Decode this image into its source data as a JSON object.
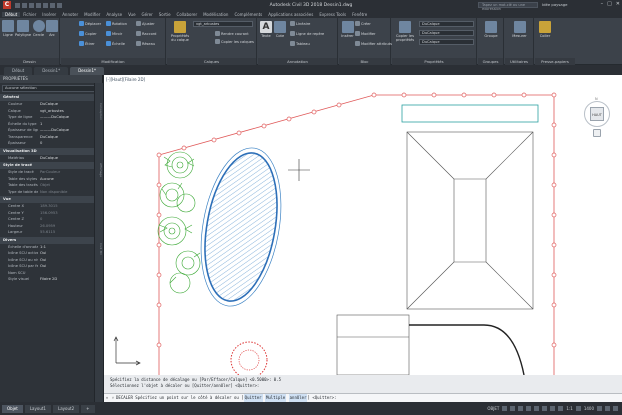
{
  "app": {
    "title": "Autodesk Civil 3D 2018   Dessin1.dwg",
    "search_placeholder": "Tapez un mot-clé ou une expression",
    "user_label": "Idée paysage"
  },
  "ribbon_tabs": [
    "Début",
    "Fichier",
    "Insérer",
    "Annoter",
    "Modifier",
    "Analyse",
    "Vue",
    "Gérer",
    "Sortie",
    "Collaborer",
    "Modélisation",
    "Compléments",
    "Applications associées",
    "Express Tools",
    "Fenêtre"
  ],
  "ribbon": {
    "draw": {
      "title": "Dessin",
      "buttons": [
        "Ligne",
        "Polyligne",
        "Cercle",
        "Arc"
      ]
    },
    "modify": {
      "title": "Modification",
      "buttons": [
        "Déplacer",
        "Rotation",
        "Ajuster",
        "Copier",
        "Miroir",
        "Raccord",
        "Étirer",
        "Échelle",
        "Réseau"
      ]
    },
    "layers": {
      "title": "Calques",
      "big": "Propriétés du calque",
      "combo": "vgt_arbustes",
      "buttons": [
        "Rendre courant",
        "Copier les calques"
      ]
    },
    "annotation": {
      "title": "Annotation",
      "big": "Texte",
      "buttons": [
        "Linéaire",
        "Ligne de repère",
        "Tableau"
      ],
      "cote": "Cote"
    },
    "block": {
      "title": "Bloc",
      "big": "Insérer",
      "buttons": [
        "Créer",
        "Modifier",
        "Modifier attributs"
      ]
    },
    "properties": {
      "title": "Propriétés",
      "big": "Copier les propriétés",
      "combos": [
        "DuCalque",
        "DuCalque",
        "DuCalque"
      ]
    },
    "groups": {
      "title": "Groupes",
      "big": "Groupe"
    },
    "utilities": {
      "title": "Utilitaires",
      "big": "Mesurer"
    },
    "clipboard": {
      "title": "Presse-papiers",
      "big": "Coller"
    }
  },
  "file_tabs": [
    "Début",
    "Dessin1*",
    "Dessin1*"
  ],
  "properties": {
    "header": "PROPRIÉTÉS",
    "selection": "Aucune sélection",
    "sections": [
      {
        "title": "Général",
        "rows": [
          {
            "k": "Couleur",
            "v": "DuCalque"
          },
          {
            "k": "Calque",
            "v": "vgt_arbustes"
          },
          {
            "k": "Type de ligne",
            "v": "———DuCalque"
          },
          {
            "k": "Échelle du type de...",
            "v": "1"
          },
          {
            "k": "Épaisseur de ligne",
            "v": "———DuCalque"
          },
          {
            "k": "Transparence",
            "v": "DuCalque"
          },
          {
            "k": "Épaisseur",
            "v": "0"
          }
        ]
      },
      {
        "title": "Visualisation 3D",
        "rows": [
          {
            "k": "Matériau",
            "v": "DuCalque"
          }
        ]
      },
      {
        "title": "Style de tracé",
        "rows": [
          {
            "k": "Style de tracé",
            "v": "ParCouleur",
            "dim": true
          },
          {
            "k": "Table des styles de...",
            "v": "Aucune"
          },
          {
            "k": "Table des tracés att...",
            "v": "Objet",
            "dim": true
          },
          {
            "k": "Type de table de tr...",
            "v": "Non disponible",
            "dim": true
          }
        ]
      },
      {
        "title": "Vue",
        "rows": [
          {
            "k": "Centre X",
            "v": "189.3015",
            "dim": true
          },
          {
            "k": "Centre Y",
            "v": "156.0953",
            "dim": true
          },
          {
            "k": "Centre Z",
            "v": "0",
            "dim": true
          },
          {
            "k": "Hauteur",
            "v": "26.0959",
            "dim": true
          },
          {
            "k": "Largeur",
            "v": "55.6115",
            "dim": true
          }
        ]
      },
      {
        "title": "Divers",
        "rows": [
          {
            "k": "Échelle d'annotation",
            "v": "1:1"
          },
          {
            "k": "Icône SCU active",
            "v": "Oui"
          },
          {
            "k": "Icône SCU au niveau...",
            "v": "Oui"
          },
          {
            "k": "Icône SCU par fenê...",
            "v": "Oui"
          },
          {
            "k": "Nom SCU",
            "v": ""
          },
          {
            "k": "Style visuel",
            "v": "Filaire 2D"
          }
        ]
      }
    ],
    "sidebar_labels": [
      "Conception",
      "Affichage",
      "Civil 3D"
    ]
  },
  "canvas": {
    "view_label": "[-][Haut][Filaire 2D]",
    "viewcube_label": "HAUT",
    "compass_n": "N"
  },
  "command": {
    "history": [
      "Spécifiez la distance de décalage ou [Par/Effacer/Calque] <0.5000>: 0.5",
      "Sélectionnez l'objet à décaler ou [Quitter/annUler] <Quitter>:"
    ],
    "prompt": "DECALER Spécifiez un point sur le côté à décaler ou",
    "opt1": "Quitter",
    "opt2": "Multiple",
    "opt3": "annUler",
    "tail": "<Quitter>:"
  },
  "status": {
    "layout_tabs": [
      "Objet",
      "Layout1",
      "Layout2"
    ],
    "model": "OBJET",
    "scale": "1:1",
    "zoom": "1400"
  }
}
